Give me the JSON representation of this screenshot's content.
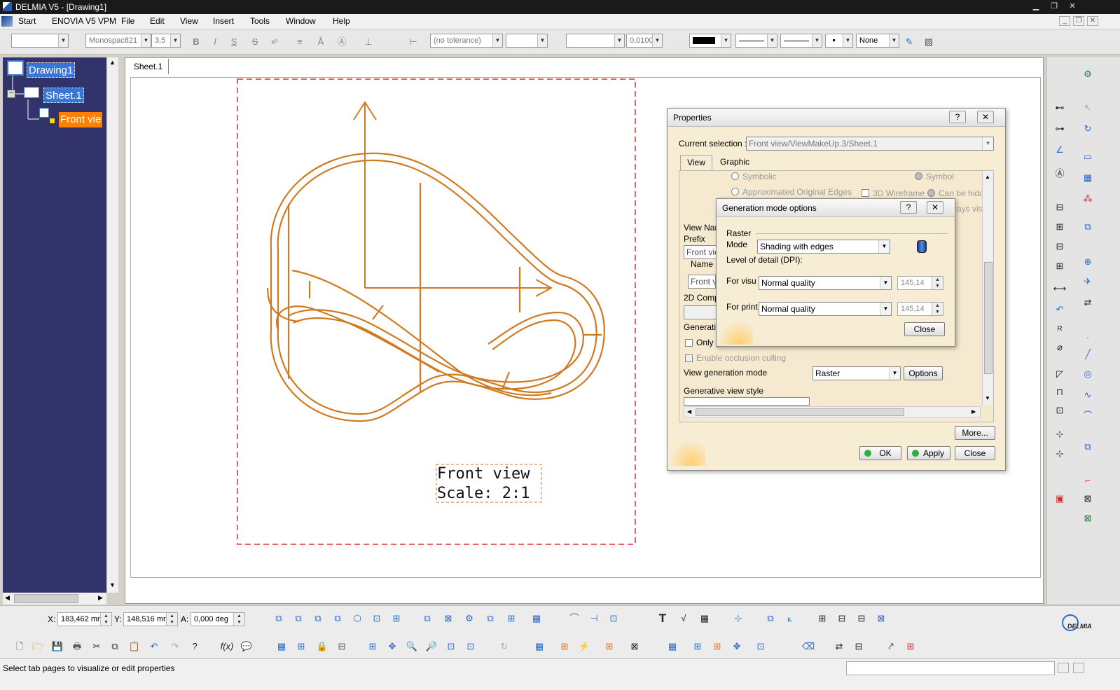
{
  "window": {
    "title": "DELMIA V5 - [Drawing1]"
  },
  "menu": {
    "items": [
      "Start",
      "ENOVIA V5 VPM",
      "File",
      "Edit",
      "View",
      "Insert",
      "Tools",
      "Window",
      "Help"
    ]
  },
  "toolbar_top": {
    "font_name": "Monospac821",
    "font_size": "3,5",
    "tolerance": "(no tolerance)",
    "precision": "0,0100",
    "line_none": "None"
  },
  "tree": {
    "root": "Drawing1",
    "sheet": "Sheet.1",
    "view": "Front vie"
  },
  "sheet_tab": "Sheet.1",
  "drawing": {
    "view_label_line1": "Front view",
    "view_label_line2": "Scale:  2:1",
    "stroke_color": "#d07a20"
  },
  "properties_dialog": {
    "title": "Properties",
    "current_selection_label": "Current selection :",
    "current_selection_value": "Front view/ViewMakeUp.3/Sheet.1",
    "tabs": [
      "View",
      "Graphic"
    ],
    "active_tab": "View",
    "opt_symbolic": "Symbolic",
    "opt_symbol": "Symbol",
    "opt_approx_edges": "Approximated Original Edges",
    "opt_3d_wireframe": "3D Wireframe",
    "opt_can_be_hidden": "Can be hidd",
    "opt_always_visible": "ays vis",
    "view_name_label": "View Nar",
    "prefix_label": "Prefix",
    "prefix_value": "Front vie",
    "name_label": "Name",
    "name_value": "Front v",
    "comp_label": "2D Comp",
    "generation_label": "Generatio",
    "only_label": "Only g",
    "enable_culling": "Enable occlusion culling",
    "view_gen_mode_label": "View generation mode",
    "view_gen_mode_value": "Raster",
    "options_button": "Options",
    "generative_style_label": "Generative view style",
    "more_button": "More...",
    "ok_button": "OK",
    "apply_button": "Apply",
    "close_button": "Close"
  },
  "generation_dialog": {
    "title": "Generation mode options",
    "raster_label": "Raster",
    "mode_label": "Mode",
    "mode_value": "Shading with edges",
    "lod_label": "Level of detail (DPI):",
    "for_visu_label": "For visu",
    "for_visu_value": "Normal quality",
    "for_visu_dpi": "145,14",
    "for_print_label": "For print",
    "for_print_value": "Normal quality",
    "for_print_dpi": "145,14",
    "close_button": "Close"
  },
  "bottom_toolbar": {
    "x_label": "X:",
    "x_value": "183,462 mr",
    "y_label": "Y:",
    "y_value": "148,516 mr",
    "a_label": "A:",
    "a_value": "0,000 deg"
  },
  "brand": "DELMIA",
  "status": {
    "text": "Select tab pages to visualize or edit properties"
  }
}
